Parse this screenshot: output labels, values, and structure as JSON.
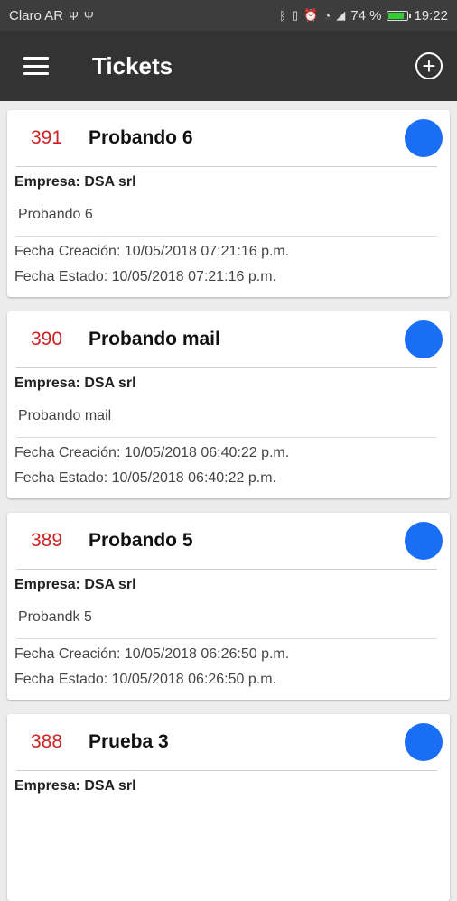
{
  "status_bar": {
    "carrier": "Claro AR",
    "battery": "74 %",
    "battery_level": 0.74,
    "time": "19:22",
    "icons": [
      "usb-icon",
      "usb-icon",
      "bluetooth-icon",
      "vibrate-icon",
      "alarm-icon",
      "wifi-icon",
      "signal-icon",
      "battery-icon"
    ]
  },
  "appbar": {
    "title": "Tickets",
    "menu_icon": "menu-icon",
    "add_icon": "add-circle-icon"
  },
  "labels": {
    "empresa": "Empresa:",
    "fecha_creacion": "Fecha Creación:",
    "fecha_estado": "Fecha Estado:"
  },
  "tickets": [
    {
      "number": "391",
      "title": "Probando 6",
      "company": "Empresa: DSA srl",
      "description": "Probando 6",
      "created": "Fecha Creación: 10/05/2018 07:21:16 p.m.",
      "status_date": "Fecha Estado: 10/05/2018 07:21:16 p.m.",
      "status_color": "#1a6ef5"
    },
    {
      "number": "390",
      "title": "Probando mail",
      "company": "Empresa: DSA srl",
      "description": "Probando mail",
      "created": "Fecha Creación: 10/05/2018 06:40:22 p.m.",
      "status_date": "Fecha Estado: 10/05/2018 06:40:22 p.m.",
      "status_color": "#1a6ef5"
    },
    {
      "number": "389",
      "title": "Probando 5",
      "company": "Empresa: DSA srl",
      "description": "Probandk 5",
      "created": "Fecha Creación: 10/05/2018 06:26:50 p.m.",
      "status_date": "Fecha Estado: 10/05/2018 06:26:50 p.m.",
      "status_color": "#1a6ef5"
    },
    {
      "number": "388",
      "title": "Prueba 3",
      "company": "Empresa: DSA srl",
      "description": "",
      "created": "",
      "status_date": "",
      "status_color": "#1a6ef5"
    }
  ],
  "colors": {
    "appbar": "#333333",
    "statusbar": "#3d3d3d",
    "ticket_number": "#cc2222",
    "status_dot": "#1a6ef5",
    "background": "#ececec"
  }
}
